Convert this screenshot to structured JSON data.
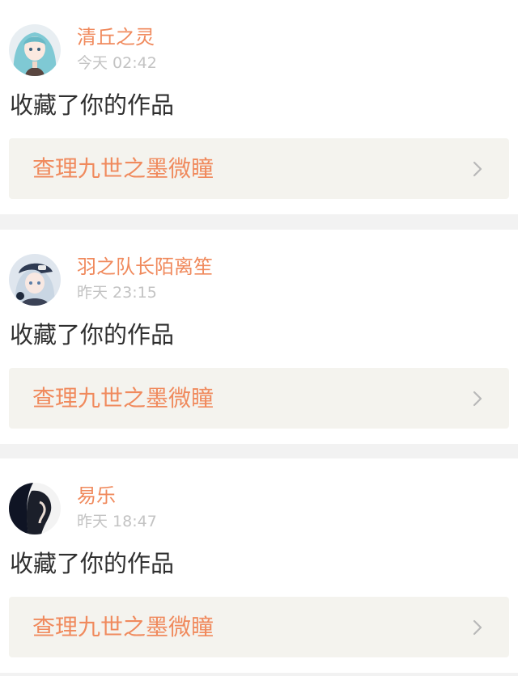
{
  "notifications": [
    {
      "user_name": "清丘之灵",
      "time": "今天 02:42",
      "action": "收藏了你的作品",
      "work_title": "查理九世之墨微瞳",
      "avatar_icon": "anime-girl-teal-hair-avatar"
    },
    {
      "user_name": "羽之队长陌离笙",
      "time": "昨天 23:15",
      "action": "收藏了你的作品",
      "work_title": "查理九世之墨微瞳",
      "avatar_icon": "anime-boy-cap-avatar"
    },
    {
      "user_name": "易乐",
      "time": "昨天 18:47",
      "action": "收藏了你的作品",
      "work_title": "查理九世之墨微瞳",
      "avatar_icon": "dark-silhouette-avatar"
    }
  ],
  "colors": {
    "accent": "#f08a5d",
    "timestamp": "#c3c3c3",
    "link_bg": "#f4f3ee",
    "separator": "#f2f2f2"
  }
}
